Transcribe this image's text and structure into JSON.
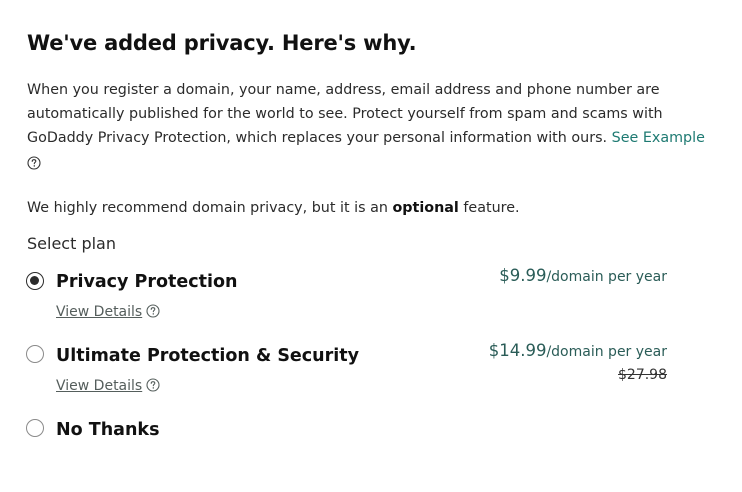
{
  "header": {
    "title": "We've added privacy. Here's why."
  },
  "intro": {
    "text": "When you register a domain, your name, address, email address and phone number are automatically published for the world to see. Protect yourself from spam and scams with GoDaddy Privacy Protection, which replaces your personal information with ours.",
    "example_link": "See Example"
  },
  "recommendation": {
    "before": "We highly recommend domain privacy, but it is an ",
    "emphasis": "optional",
    "after": " feature."
  },
  "plan_section": {
    "label": "Select plan",
    "plans": [
      {
        "name": "Privacy Protection",
        "details_link": "View Details",
        "price": "$9.99",
        "period": "/domain per year",
        "selected": true
      },
      {
        "name": "Ultimate Protection & Security",
        "details_link": "View Details",
        "price": "$14.99",
        "period": "/domain per year",
        "original_price": "$27.98",
        "selected": false
      },
      {
        "name": "No Thanks",
        "selected": false
      }
    ]
  },
  "colors": {
    "link": "#1e7a72",
    "price": "#2a5c57",
    "text": "#111111"
  }
}
